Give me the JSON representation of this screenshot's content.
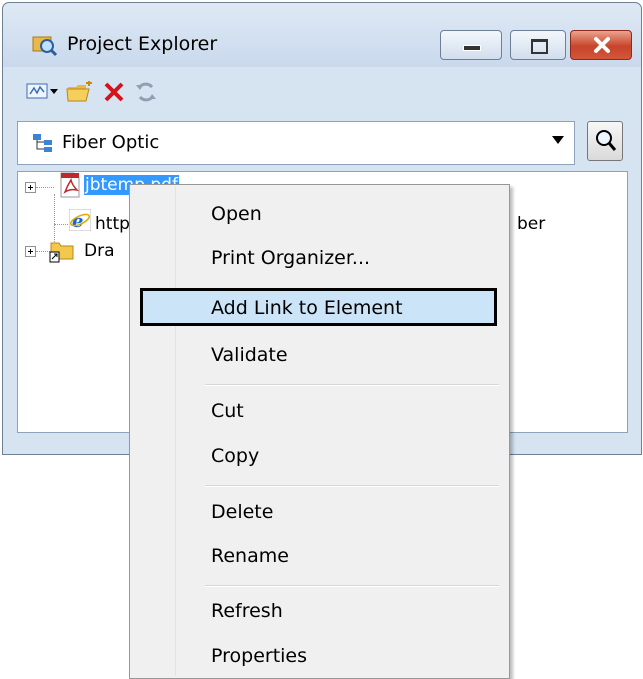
{
  "window": {
    "title": "Project Explorer",
    "buttons": {
      "minimize": "minimize",
      "maximize": "maximize",
      "close": "close"
    }
  },
  "toolbar": {
    "icons": [
      "new-link-icon",
      "dropdown-arrow-icon",
      "open-folder-icon",
      "delete-icon",
      "refresh-icon"
    ]
  },
  "combo": {
    "value": "Fiber Optic",
    "icon": "hierarchy-icon"
  },
  "tree": {
    "items": [
      {
        "label": "jbtemp.pdf",
        "visible_label": "jbtemp.pdf",
        "icon": "pdf-icon",
        "selected": true
      },
      {
        "label": "http",
        "trailing": "ber",
        "icon": "ie-icon"
      },
      {
        "label": "Dra",
        "icon": "folder-icon"
      }
    ]
  },
  "context_menu": {
    "items": [
      {
        "label": "Open"
      },
      {
        "label": "Print Organizer..."
      },
      {
        "label": "Add Link to Element",
        "highlighted": true
      },
      {
        "label": "Validate"
      },
      {
        "label": "Cut"
      },
      {
        "label": "Copy"
      },
      {
        "label": "Delete"
      },
      {
        "label": "Rename"
      },
      {
        "label": "Refresh"
      },
      {
        "label": "Properties"
      }
    ]
  },
  "colors": {
    "selection": "#3399ff",
    "menu_highlight": "#cce4f7",
    "close_button": "#c7442a"
  }
}
